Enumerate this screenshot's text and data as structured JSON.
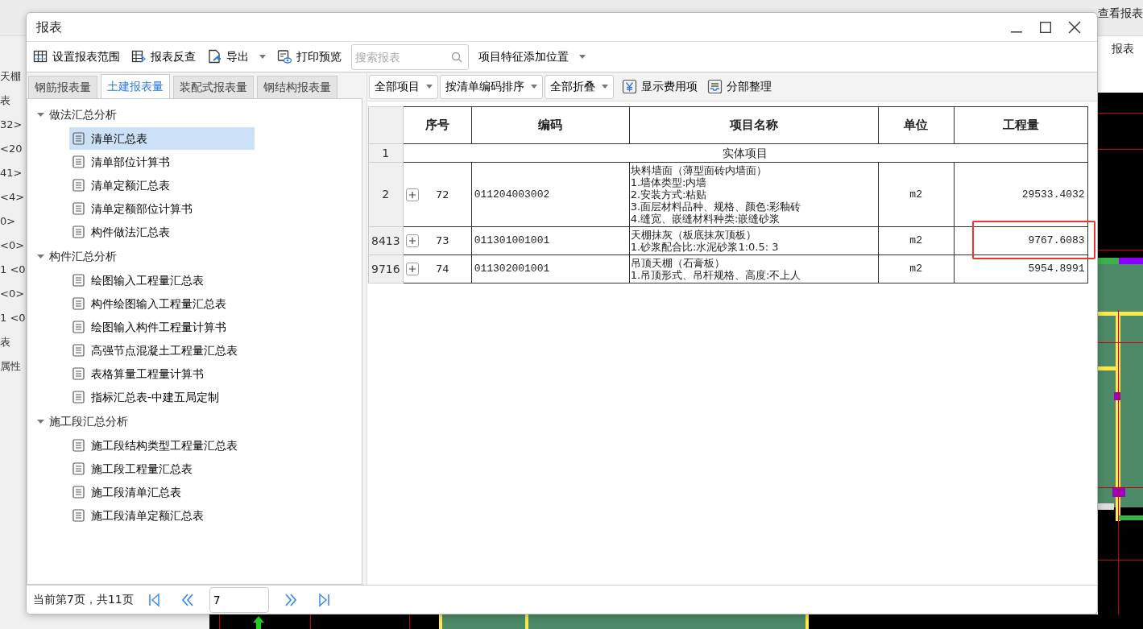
{
  "background_app": {
    "toolbar_button": "查看报表",
    "panel_title": "报表",
    "side_labels": [
      "天棚",
      "表",
      "32>",
      "<20",
      "41>",
      "<4>",
      "0>",
      "<0>",
      "1 <0",
      "<0>",
      "1 <0",
      "表",
      "属性"
    ]
  },
  "window": {
    "title": "报表"
  },
  "toolbar": [
    {
      "kind": "button",
      "label": "设置报表范围"
    },
    {
      "kind": "button",
      "label": "报表反查"
    },
    {
      "kind": "dropdown",
      "label": "导出"
    },
    {
      "kind": "button",
      "label": "打印预览"
    },
    {
      "kind": "search",
      "placeholder": "搜索报表"
    },
    {
      "kind": "dropdown",
      "label": "项目特征添加位置"
    }
  ],
  "tabs": [
    {
      "label": "钢筋报表量",
      "selected": false
    },
    {
      "label": "土建报表量",
      "selected": true
    },
    {
      "label": "装配式报表量",
      "selected": false
    },
    {
      "label": "钢结构报表量",
      "selected": false
    }
  ],
  "tree": [
    {
      "label": "做法汇总分析",
      "expanded": true,
      "children": [
        {
          "label": "清单汇总表",
          "selected": true
        },
        {
          "label": "清单部位计算书",
          "selected": false
        },
        {
          "label": "清单定额汇总表",
          "selected": false
        },
        {
          "label": "清单定额部位计算书",
          "selected": false
        },
        {
          "label": "构件做法汇总表",
          "selected": false
        }
      ]
    },
    {
      "label": "构件汇总分析",
      "expanded": true,
      "children": [
        {
          "label": "绘图输入工程量汇总表",
          "selected": false
        },
        {
          "label": "构件绘图输入工程量汇总表",
          "selected": false
        },
        {
          "label": "绘图输入构件工程量计算书",
          "selected": false
        },
        {
          "label": "高强节点混凝土工程量汇总表",
          "selected": false
        },
        {
          "label": "表格算量工程量计算书",
          "selected": false
        },
        {
          "label": "指标汇总表-中建五局定制",
          "selected": false
        }
      ]
    },
    {
      "label": "施工段汇总分析",
      "expanded": true,
      "children": [
        {
          "label": "施工段结构类型工程量汇总表",
          "selected": false
        },
        {
          "label": "施工段工程量汇总表",
          "selected": false
        },
        {
          "label": "施工段清单汇总表",
          "selected": false
        },
        {
          "label": "施工段清单定额汇总表",
          "selected": false
        }
      ]
    }
  ],
  "report_toolbar": [
    {
      "kind": "dropdown",
      "label": "全部项目"
    },
    {
      "kind": "dropdown",
      "label": "按清单编码排序"
    },
    {
      "kind": "dropdown",
      "label": "全部折叠"
    },
    {
      "kind": "button",
      "label": "显示费用项"
    },
    {
      "kind": "button",
      "label": "分部整理"
    }
  ],
  "table": {
    "columns": [
      "序号",
      "编码",
      "项目名称",
      "单位",
      "工程量"
    ],
    "rows": [
      {
        "kind": "section",
        "row_header": "1",
        "name_lines": [
          "实体项目"
        ]
      },
      {
        "kind": "item",
        "row_header": "2",
        "expanded": false,
        "number": "72",
        "code": "011204003002",
        "name_lines": [
          "块料墙面（薄型面砖内墙面）",
          "1.墙体类型:内墙",
          "2.安装方式:粘贴",
          "3.面层材料品种、规格、颜色:彩釉砖",
          "4.缝宽、嵌缝材料种类:嵌缝砂浆"
        ],
        "unit": "m2",
        "quantity": "29533.4032",
        "highlighted": false
      },
      {
        "kind": "item",
        "row_header": "8413",
        "expanded": false,
        "number": "73",
        "code": "011301001001",
        "name_lines": [
          "天棚抹灰（板底抹灰顶板）",
          "1.砂浆配合比:水泥砂浆1:0.5: 3"
        ],
        "unit": "m2",
        "quantity": "9767.6083",
        "highlighted": true
      },
      {
        "kind": "item",
        "row_header": "9716",
        "expanded": false,
        "number": "74",
        "code": "011302001001",
        "name_lines": [
          "吊顶天棚（石膏板）",
          "1.吊顶形式、吊杆规格、高度:不上人"
        ],
        "unit": "m2",
        "quantity": "5954.8991",
        "highlighted": false
      }
    ]
  },
  "footer": {
    "page_info": "当前第7页，共11页",
    "page_input": "7"
  }
}
